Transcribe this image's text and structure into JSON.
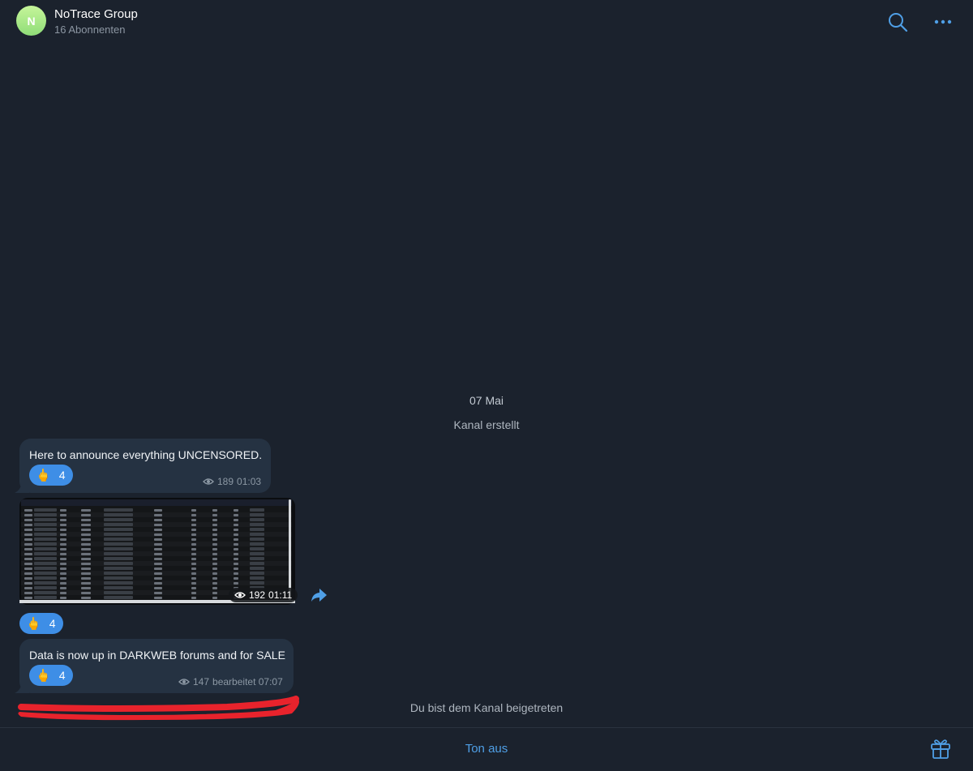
{
  "header": {
    "avatar_letter": "N",
    "title": "NoTrace Group",
    "subtitle": "16 Abonnenten",
    "search_icon": "search-icon",
    "more_icon": "more-horizontal-icon"
  },
  "chat": {
    "date_label": "07 Mai",
    "service_created": "Kanal erstellt",
    "service_joined": "Du bist dem Kanal beigetreten",
    "messages": [
      {
        "text": "Here to announce everything UNCENSORED.",
        "reaction_emoji": "🖕",
        "reaction_count": "4",
        "views": "189",
        "time": "01:03"
      },
      {
        "type": "image",
        "image_description_icon": "spreadsheet-screenshot",
        "views": "192",
        "time": "01:11",
        "reaction_emoji": "🖕",
        "reaction_count": "4"
      },
      {
        "text": "Data is now up in DARKWEB forums and for SALE",
        "reaction_emoji": "🖕",
        "reaction_count": "4",
        "views": "147",
        "edited_time": "bearbeitet 07:07"
      }
    ]
  },
  "footer": {
    "mute_label": "Ton aus",
    "gift_icon": "gift-icon"
  },
  "colors": {
    "background": "#1b222d",
    "bubble": "#253242",
    "accent": "#4f9fe6",
    "reaction": "#3e8ee6",
    "redaction": "#e8232c"
  }
}
